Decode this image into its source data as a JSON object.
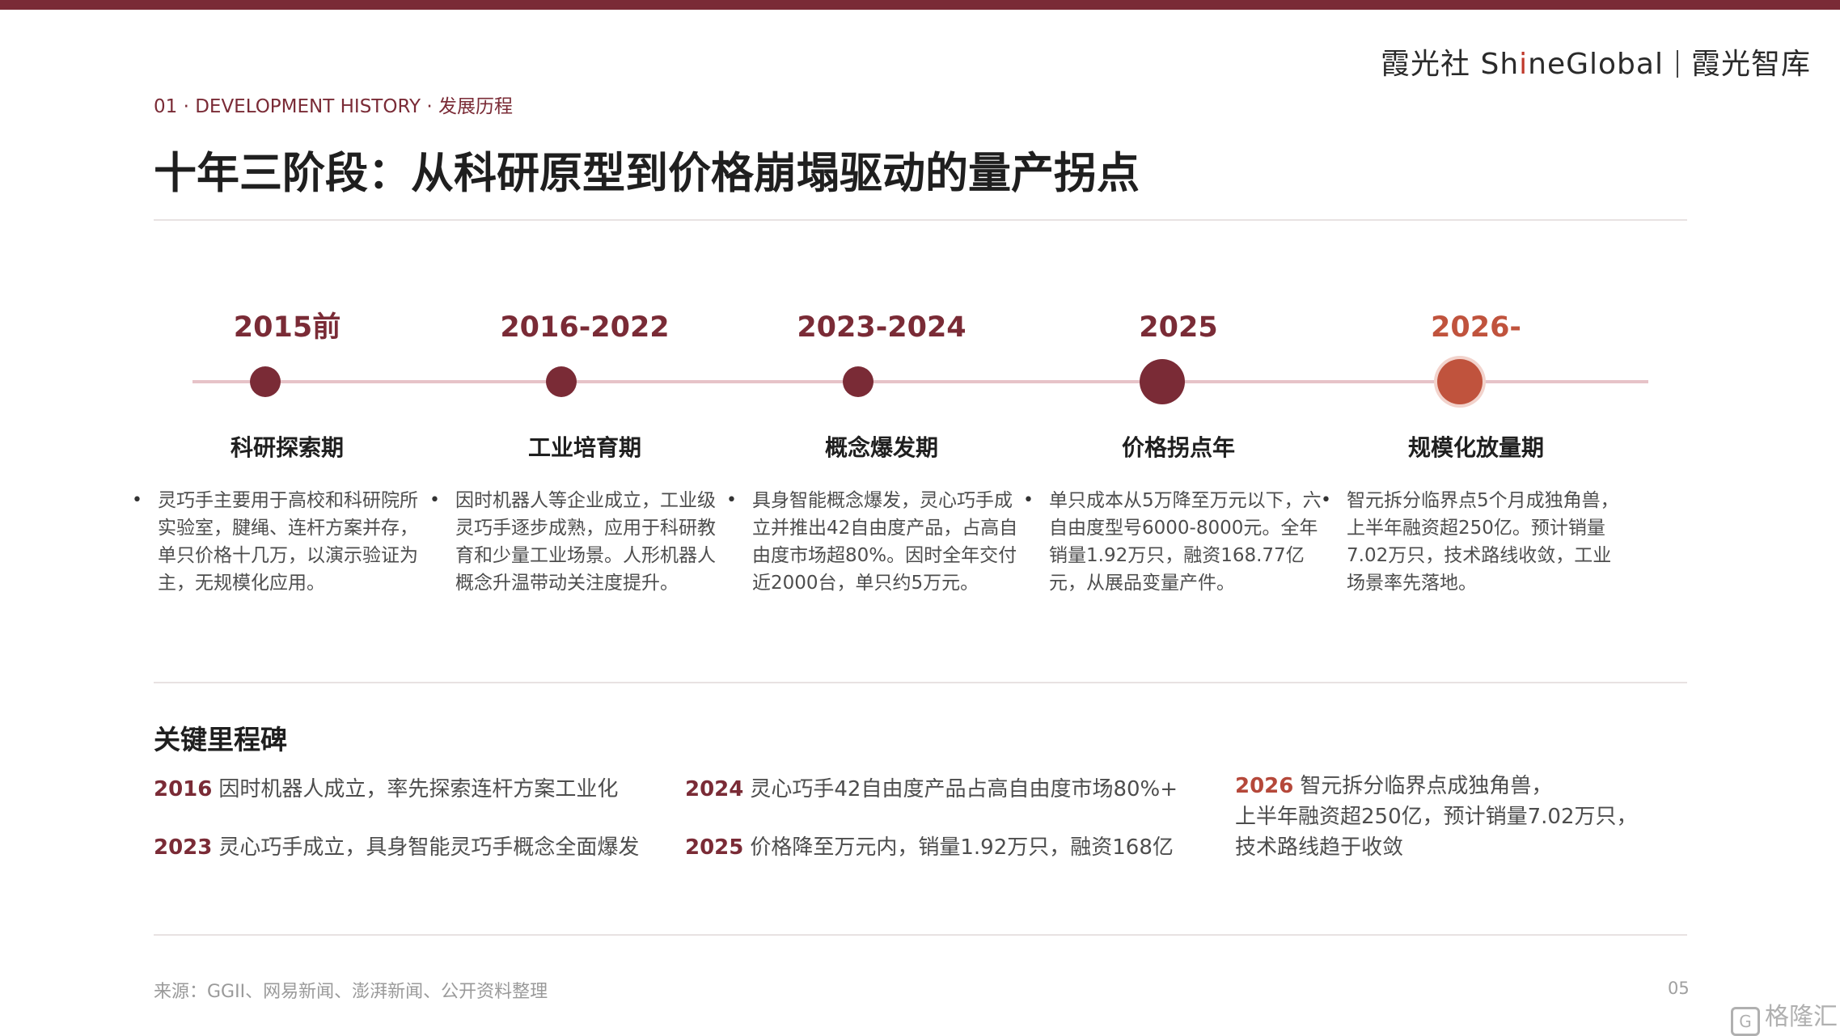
{
  "brand": {
    "name_left_a": "霞光社 Sh",
    "name_left_i": "i",
    "name_left_b": "neGlobal",
    "name_right": "霞光智库"
  },
  "section_label": "01 · DEVELOPMENT HISTORY · 发展历程",
  "title": "十年三阶段：从科研原型到价格崩塌驱动的量产拐点",
  "stages": [
    {
      "year": "2015前",
      "phase": "科研探索期",
      "desc": "灵巧手主要用于高校和科研院所实验室，腱绳、连杆方案并存，单只价格十几万，以演示验证为主，无规模化应用。"
    },
    {
      "year": "2016-2022",
      "phase": "工业培育期",
      "desc": "因时机器人等企业成立，工业级灵巧手逐步成熟，应用于科研教育和少量工业场景。人形机器人概念升温带动关注度提升。"
    },
    {
      "year": "2023-2024",
      "phase": "概念爆发期",
      "desc": "具身智能概念爆发，灵心巧手成立并推出42自由度产品，占高自由度市场超80%。因时全年交付近2000台，单只约5万元。"
    },
    {
      "year": "2025",
      "phase": "价格拐点年",
      "desc": "单只成本从5万降至万元以下，六自由度型号6000-8000元。全年销量1.92万只，融资168.77亿元，从展品变量产件。"
    },
    {
      "year": "2026-",
      "phase": "规模化放量期",
      "desc": "智元拆分临界点5个月成独角兽，上半年融资超250亿。预计销量7.02万只，技术路线收敛，工业场景率先落地。"
    }
  ],
  "milestones_title": "关键里程碑",
  "milestones": [
    {
      "year": "2016",
      "text": "因时机器人成立，率先探索连杆方案工业化"
    },
    {
      "year": "2023",
      "text": "灵心巧手成立，具身智能灵巧手概念全面爆发"
    },
    {
      "year": "2024",
      "text": "灵心巧手42自由度产品占高自由度市场80%+"
    },
    {
      "year": "2025",
      "text": "价格降至万元内，销量1.92万只，融资168亿"
    },
    {
      "year": "2026",
      "line1": "智元拆分临界点成独角兽，",
      "line2": "上半年融资超250亿，预计销量7.02万只，",
      "line3": "技术路线趋于收敛"
    }
  ],
  "source": "来源：GGII、网易新闻、澎湃新闻、公开资料整理",
  "page_number": "05",
  "watermark": "格隆汇",
  "colors": {
    "accent": "#7a2b36",
    "future": "#c0533d",
    "axis": "#e6c3c8"
  }
}
